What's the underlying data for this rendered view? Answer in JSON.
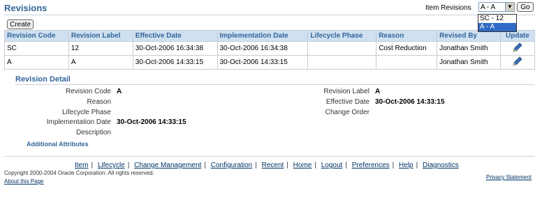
{
  "header": {
    "title": "Revisions",
    "item_revisions_label": "Item Revisions",
    "selected_revision": "A - A",
    "go_label": "Go"
  },
  "dropdown": {
    "options": [
      "SC - 12",
      "A - A"
    ]
  },
  "toolbar": {
    "create_label": "Create"
  },
  "table": {
    "columns": [
      "Revision Code",
      "Revision Label",
      "Effective Date",
      "Implementation Date",
      "Lifecycle Phase",
      "Reason",
      "Revised By",
      "Update"
    ],
    "rows": [
      {
        "code": "SC",
        "label": "12",
        "effective": "30-Oct-2006 16:34:38",
        "implementation": "30-Oct-2006 16:34:38",
        "phase": "",
        "reason": "Cost Reduction",
        "revised_by": "Jonathan Smith"
      },
      {
        "code": "A",
        "label": "A",
        "effective": "30-Oct-2006 14:33:15",
        "implementation": "30-Oct-2006 14:33:15",
        "phase": "",
        "reason": "",
        "revised_by": "Jonathan Smith"
      }
    ],
    "update_icon": "pencil-icon"
  },
  "detail": {
    "title": "Revision Detail",
    "labels": {
      "revision_code": "Revision Code",
      "reason": "Reason",
      "lifecycle_phase": "Lifecycle Phase",
      "implementation_date": "Implementation Date",
      "description": "Description",
      "revision_label": "Revision Label",
      "effective_date": "Effective Date",
      "change_order": "Change Order"
    },
    "values": {
      "revision_code": "A",
      "implementation_date": "30-Oct-2006 14:33:15",
      "revision_label": "A",
      "effective_date": "30-Oct-2006 14:33:15"
    },
    "additional_attributes": "Additional Attributes"
  },
  "footer": {
    "links": [
      "Item",
      "Lifecycle",
      "Change Management",
      "Configuration",
      "Recent",
      "Home",
      "Logout",
      "Preferences",
      "Help",
      "Diagnostics"
    ],
    "copyright": "Copyright 2000-2004 Oracle Corporation. All rights reserved.",
    "about": "About this Page",
    "privacy": "Privacy Statement"
  },
  "colors": {
    "accent": "#336699",
    "header_bg": "#cfe0f1",
    "link": "#003366"
  }
}
